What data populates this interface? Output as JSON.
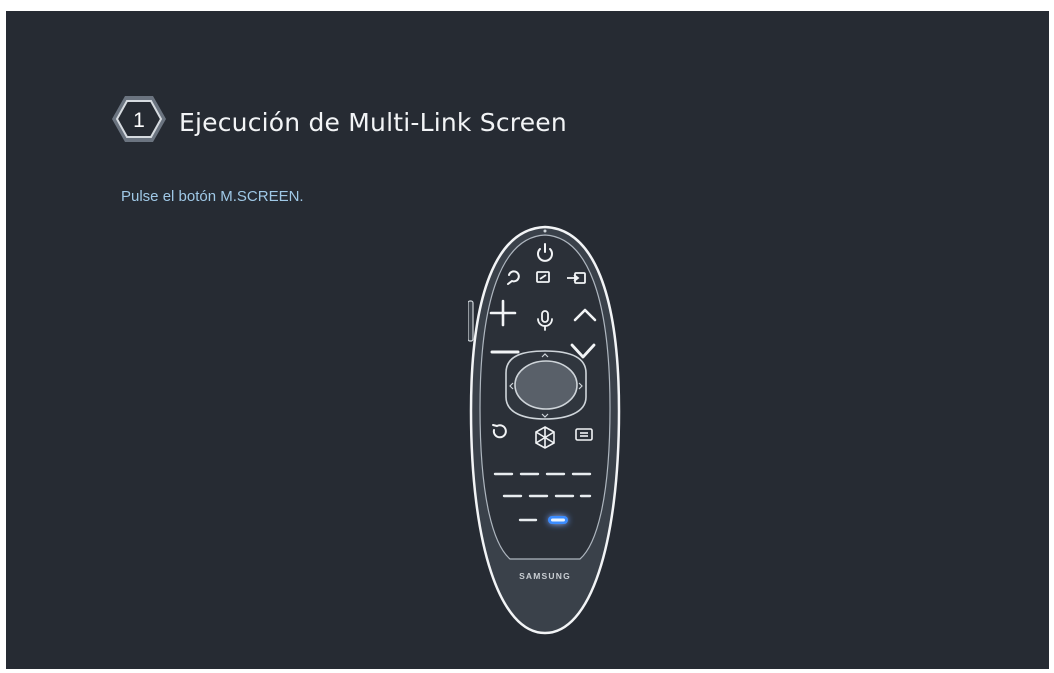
{
  "step": {
    "number": "1",
    "title": "Ejecución de Multi-Link Screen"
  },
  "instruction": "Pulse el botón M.SCREEN.",
  "remote": {
    "brand": "SAMSUNG",
    "highlighted_button": "m-screen-button",
    "highlight_color": "#3b8cff"
  }
}
